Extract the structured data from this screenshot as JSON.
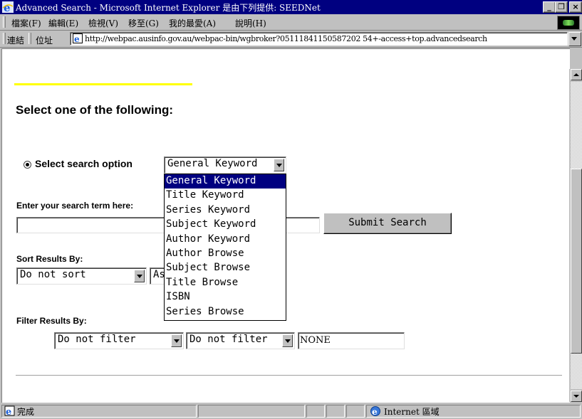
{
  "window": {
    "title": "Advanced Search - Microsoft Internet Explorer 是由下列提供: SEEDNet",
    "minimize": "_",
    "restore": "❐",
    "close": "×"
  },
  "menubar": {
    "items": [
      "檔案(F)",
      "編輯(E)",
      "檢視(V)",
      "移至(G)",
      "我的最愛(A)",
      "說明(H)"
    ]
  },
  "addressbar": {
    "links_label": "連結",
    "address_label": "位址",
    "url": "http://webpac.ausinfo.gov.au/webpac-bin/wgbroker?05111841150587202 54+-access+top.advancedsearch"
  },
  "page": {
    "heading": "Select one of the following:",
    "search_option_label": "Select search option",
    "search_option_selected": "General Keyword",
    "search_options": [
      "General Keyword",
      "Title Keyword",
      "Series Keyword",
      "Subject Keyword",
      "Author Keyword",
      "Author Browse",
      "Subject Browse",
      "Title Browse",
      "ISBN",
      "Series Browse"
    ],
    "search_term_label": "Enter your search term here:",
    "search_term_value": "",
    "submit_label": "Submit Search",
    "sort_label": "Sort Results By:",
    "sort_value": "Do not sort",
    "sort_order_value": "As",
    "filter_label": "Filter Results By:",
    "filter1_value": "Do not filter",
    "filter2_value": "Do not filter",
    "filter_text_value": "NONE"
  },
  "statusbar": {
    "status_text": "完成",
    "zone_text": "Internet 區域"
  },
  "colors": {
    "titlebar": "#000080",
    "chrome": "#c0c0c0",
    "selected_option": "#000080",
    "yellow_rule": "#ffff00"
  }
}
